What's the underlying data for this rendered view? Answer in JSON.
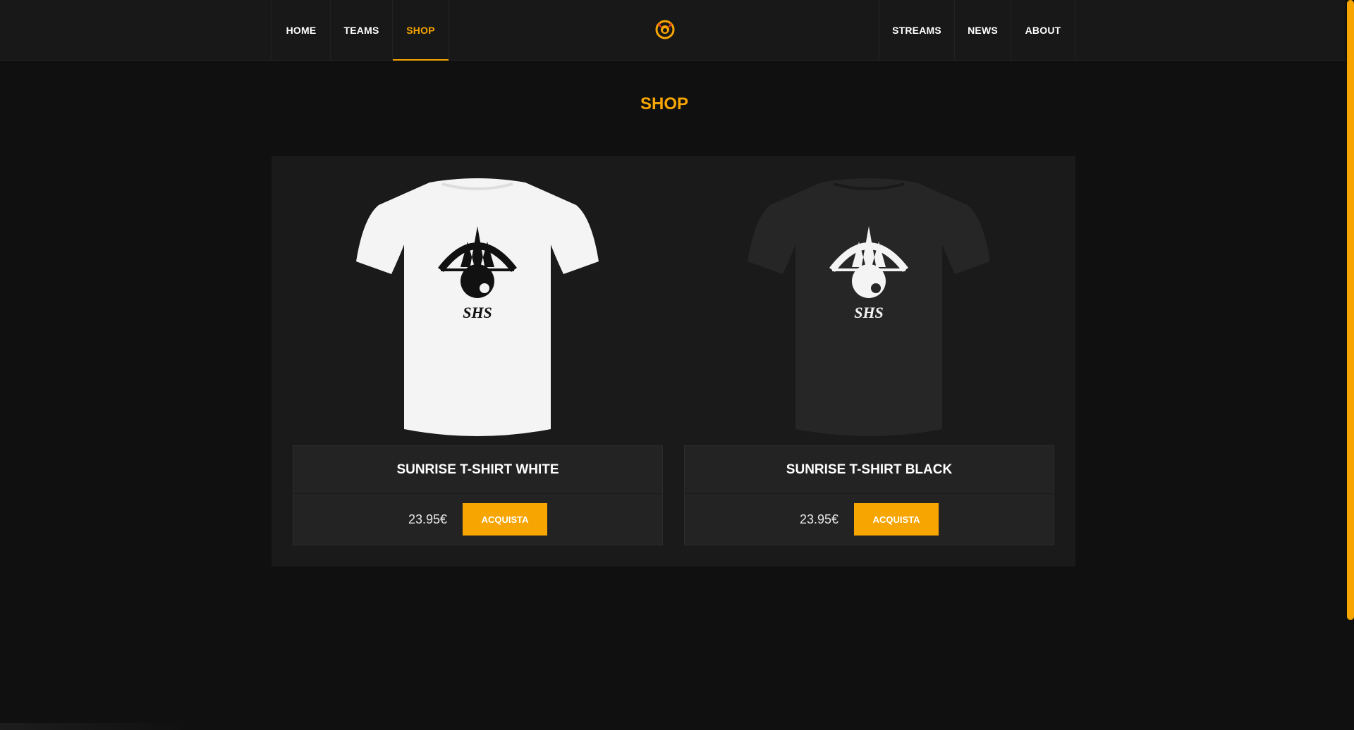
{
  "nav": {
    "left": [
      {
        "label": "HOME",
        "active": false
      },
      {
        "label": "TEAMS",
        "active": false
      },
      {
        "label": "SHOP",
        "active": true
      }
    ],
    "right": [
      {
        "label": "STREAMS",
        "active": false
      },
      {
        "label": "NEWS",
        "active": false
      },
      {
        "label": "ABOUT",
        "active": false
      }
    ],
    "logo_icon": "sunrise-logo-icon"
  },
  "page": {
    "title": "SHOP"
  },
  "products": [
    {
      "name": "SUNRISE T-SHIRT WHITE",
      "price": "23.95€",
      "button_label": "ACQUISTA",
      "shirt_color": "#f4f4f4",
      "print_color": "#111111",
      "print_text": "SHS"
    },
    {
      "name": "SUNRISE T-SHIRT BLACK",
      "price": "23.95€",
      "button_label": "ACQUISTA",
      "shirt_color": "#262626",
      "print_color": "#f4f4f4",
      "print_text": "SHS"
    }
  ],
  "colors": {
    "accent": "#f7a500",
    "background": "#101010",
    "panel": "#1a1a1a"
  }
}
